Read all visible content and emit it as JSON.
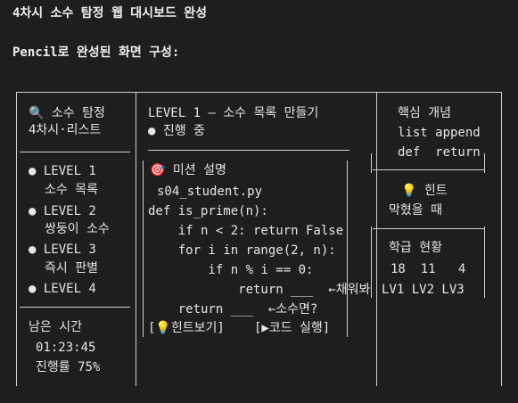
{
  "page": {
    "title": "4차시 소수 탐정 웹 대시보드 완성",
    "subtitle": "Pencil로 완성된 화면 구성:"
  },
  "sidebar": {
    "logo_icon": "🔍",
    "title_line1": "소수 탐정",
    "title_line2": "4차시·리스트",
    "levels": [
      {
        "label": "LEVEL 1",
        "desc": "소수 목록"
      },
      {
        "label": "LEVEL 2",
        "desc": "쌍둥이 소수"
      },
      {
        "label": "LEVEL 3",
        "desc": "즉시 판별"
      },
      {
        "label": "LEVEL 4",
        "desc": ""
      }
    ],
    "timer_label": "남은 시간",
    "timer_value": "01:23:45",
    "progress_label": "진행률 75%",
    "progress": 0.75
  },
  "main": {
    "level_title": "LEVEL 1 — 소수 목록 만들기",
    "status": "진행 중",
    "mission_icon": "🎯",
    "mission_title": "미션 설명",
    "file_name": "s04_student.py",
    "code": [
      "def is_prime(n):",
      "    if n < 2: return False",
      "    for i in range(2, n):",
      "        if n % i == 0:",
      "            return ___  ←채워봐",
      "    return ___  ←소수면?"
    ],
    "hint_button": "[💡힌트보기]",
    "run_button": "[▶코드 실행]"
  },
  "right": {
    "concept_title": "핵심 개념",
    "concept_row1": "list append",
    "concept_row2": "def  return",
    "hint_icon": "💡",
    "hint_title": "힌트",
    "hint_text": "막혔을 때",
    "class_title": "학급 현황",
    "class_counts": "18  11   4",
    "class_levels": "LV1 LV2 LV3"
  }
}
